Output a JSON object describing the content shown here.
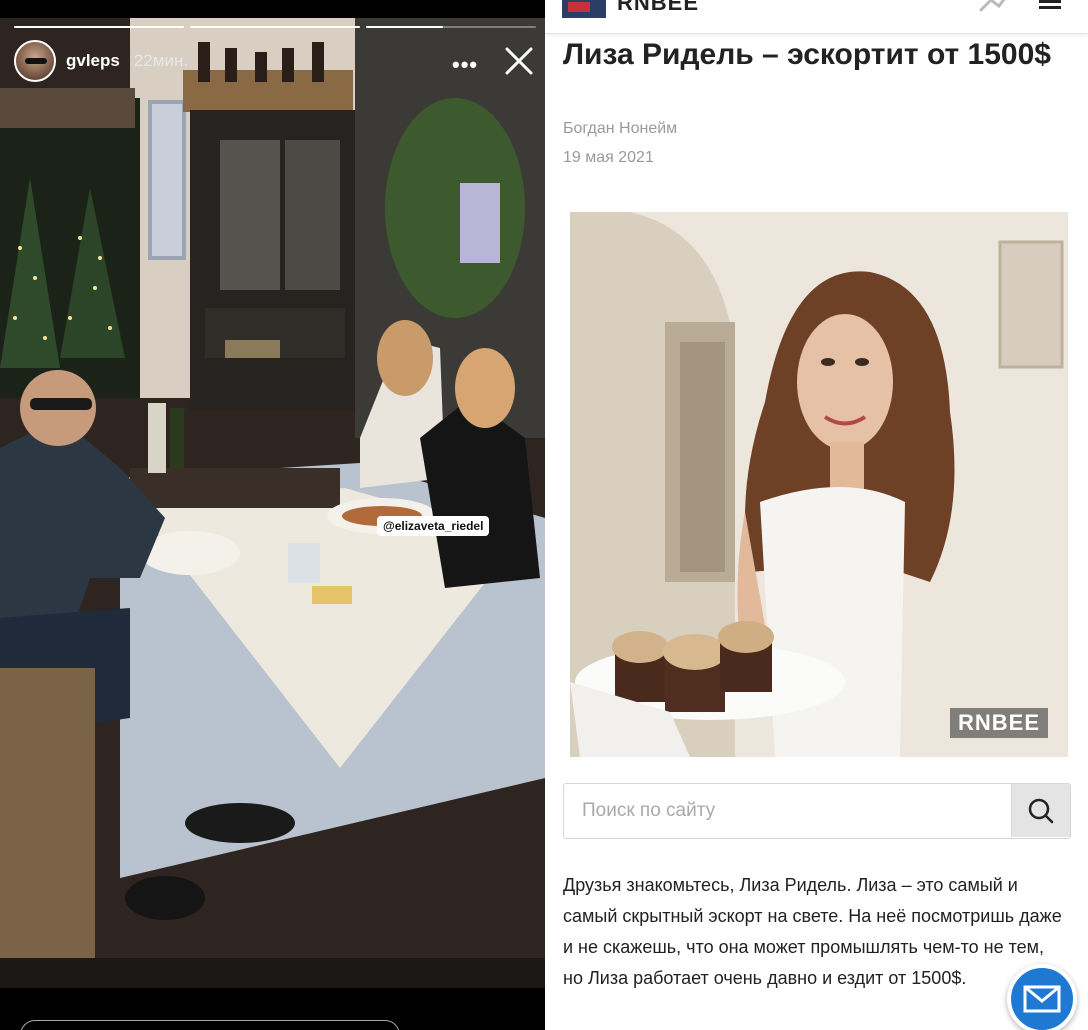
{
  "story": {
    "username": "gvleps",
    "time_ago": "22мин.",
    "mention": "@elizaveta_riedel",
    "progress": [
      1.0,
      1.0,
      0.45
    ]
  },
  "article": {
    "site": {
      "name": "RNBEE"
    },
    "title": "Лиза Ридель – эскортит от 1500$",
    "author": "Богдан Нонейм",
    "date": "19 мая 2021",
    "image_watermark": "RNBEE",
    "search": {
      "placeholder": "Поиск по сайту"
    },
    "body": "Друзья знакомьтесь, Лиза Ридель. Лиза – это самый и самый скрытный эскорт на свете.  На неё посмотришь даже и не скажешь, что она может промышлять чем-то не тем, но Лиза работает очень давно и ездит от 1500$."
  },
  "colors": {
    "accent_blue": "#1f78d1",
    "logo_navy": "#2d3e66",
    "logo_red": "#c9303e",
    "meta_gray": "#9a9a9a"
  }
}
